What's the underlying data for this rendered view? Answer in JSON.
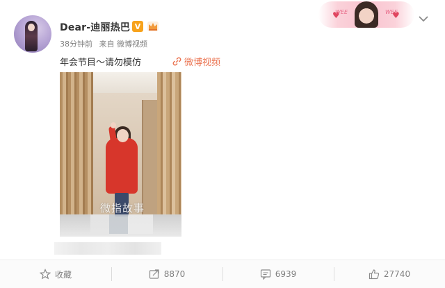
{
  "post": {
    "username": "Dear-迪丽热巴",
    "verified_badge": "V",
    "time": "38分钟前",
    "source": "来自 微博视频",
    "text": "年会节目～请勿模仿",
    "video_link_label": "微博视频",
    "video_watermark": "微指故事"
  },
  "banner": {
    "left_word": "WEE",
    "right_word": "WEE"
  },
  "footer": {
    "favorite_label": "收藏",
    "repost_count": "8870",
    "comment_count": "6939",
    "like_count": "27740"
  },
  "colors": {
    "accent_orange": "#eb7350",
    "badge_gold": "#f7a21b",
    "text_gray": "#808080"
  },
  "icons": {
    "favorite": "star-icon",
    "repost": "repost-icon",
    "comment": "comment-icon",
    "like": "thumbs-up-icon",
    "menu": "chevron-down-icon",
    "video_link": "link-icon"
  }
}
